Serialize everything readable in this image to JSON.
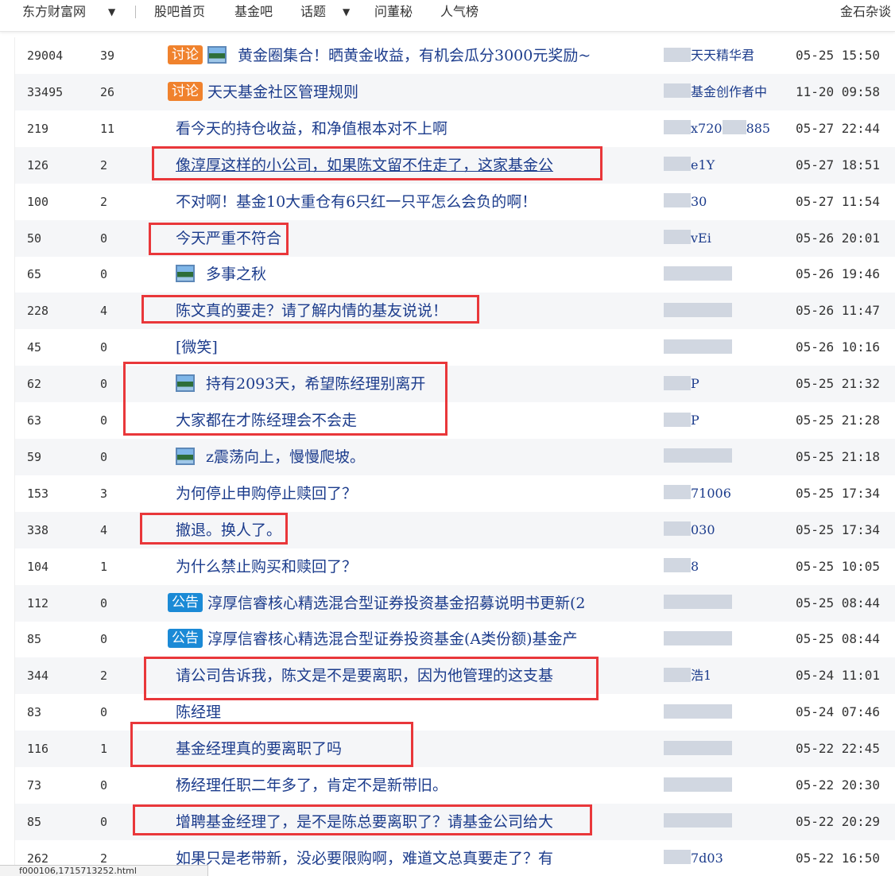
{
  "topbar": {
    "site_name": "东方财富网",
    "nav": [
      "股吧首页",
      "基金吧",
      "话题",
      "问董秘",
      "人气榜"
    ],
    "right_link": "金石杂谈",
    "caret": "▼"
  },
  "posts": [
    {
      "reads": "29004",
      "replies": "39",
      "badge": "讨论",
      "has_image": true,
      "title": "黄金圈集合！晒黄金收益，有机会瓜分3000元奖励~",
      "author": "天天精华君",
      "time": "05-25 15:50"
    },
    {
      "reads": "33495",
      "replies": "26",
      "badge": "讨论",
      "has_image": false,
      "title": "天天基金社区管理规则",
      "author": "基金创作者中",
      "time": "11-20 09:58"
    },
    {
      "reads": "219",
      "replies": "11",
      "title": "看今天的持仓收益，和净值根本对不上啊",
      "author": "x720",
      "author2": "885",
      "time": "05-27 22:44"
    },
    {
      "reads": "126",
      "replies": "2",
      "title": "像淳厚这样的小公司，如果陈文留不住走了，这家基金公",
      "author": "e1Y",
      "time": "05-27 18:51"
    },
    {
      "reads": "100",
      "replies": "2",
      "title": "不对啊！基金10大重仓有6只红一只平怎么会负的啊！",
      "author": "30",
      "time": "05-27 11:54"
    },
    {
      "reads": "50",
      "replies": "0",
      "title": "今天严重不符合",
      "author": "vEi",
      "time": "05-26 20:01"
    },
    {
      "reads": "65",
      "replies": "0",
      "has_image": true,
      "title": "多事之秋",
      "author": "",
      "time": "05-26 19:46"
    },
    {
      "reads": "228",
      "replies": "4",
      "title": "陈文真的要走？请了解内情的基友说说！",
      "author": "",
      "time": "05-26 11:47"
    },
    {
      "reads": "45",
      "replies": "0",
      "title": "[微笑]",
      "author": "",
      "time": "05-26 10:16"
    },
    {
      "reads": "62",
      "replies": "0",
      "has_image": true,
      "title": "持有2093天，希望陈经理别离开",
      "author": "P",
      "time": "05-25 21:32"
    },
    {
      "reads": "63",
      "replies": "0",
      "title": "大家都在才陈经理会不会走",
      "author": "P",
      "time": "05-25 21:28"
    },
    {
      "reads": "59",
      "replies": "0",
      "has_image": true,
      "title": "z震荡向上，慢慢爬坡。",
      "author": "",
      "time": "05-25 21:18"
    },
    {
      "reads": "153",
      "replies": "3",
      "title": "为何停止申购停止赎回了？",
      "author": "71006",
      "time": "05-25 17:34"
    },
    {
      "reads": "338",
      "replies": "4",
      "title": "撤退。换人了。",
      "author": "030",
      "time": "05-25 17:34"
    },
    {
      "reads": "104",
      "replies": "1",
      "title": "为什么禁止购买和赎回了？",
      "author": "8",
      "time": "05-25 10:05"
    },
    {
      "reads": "112",
      "replies": "0",
      "badge": "公告",
      "title": "淳厚信睿核心精选混合型证券投资基金招募说明书更新(2",
      "author": "",
      "time": "05-25 08:44"
    },
    {
      "reads": "85",
      "replies": "0",
      "badge": "公告",
      "title": "淳厚信睿核心精选混合型证券投资基金(A类份额)基金产",
      "author": "",
      "time": "05-25 08:44"
    },
    {
      "reads": "344",
      "replies": "2",
      "title": "请公司告诉我，陈文是不是要离职，因为他管理的这支基",
      "author": "浩1",
      "time": "05-24 11:01"
    },
    {
      "reads": "83",
      "replies": "0",
      "title": "陈经理",
      "author": "",
      "time": "05-24 07:46"
    },
    {
      "reads": "116",
      "replies": "1",
      "title": "基金经理真的要离职了吗",
      "author": "",
      "time": "05-22 22:45"
    },
    {
      "reads": "73",
      "replies": "0",
      "title": "杨经理任职二年多了，肯定不是新带旧。",
      "author": "",
      "time": "05-22 20:30"
    },
    {
      "reads": "85",
      "replies": "0",
      "title": "增聘基金经理了，是不是陈总要离职了？请基金公司给大",
      "author": "",
      "time": "05-22 20:29"
    },
    {
      "reads": "262",
      "replies": "2",
      "title": "如果只是老带新，没必要限购啊，难道文总真要走了？有",
      "author": "7d03",
      "time": "05-22 16:50"
    }
  ],
  "status_url": "f000106,1715713252.html",
  "colors": {
    "title": "#1c3c8c",
    "highlight": "#e9373a",
    "discuss_badge": "#f0822d",
    "notice_badge": "#1b8ad6",
    "alt_row": "#f5f6f8"
  }
}
